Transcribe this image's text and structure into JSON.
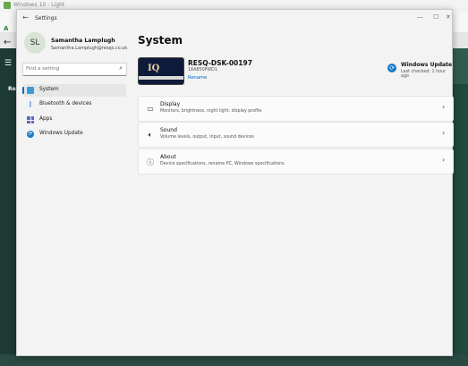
{
  "background_app": {
    "title": "Windows 10 - Light",
    "toolbar_letter": "A",
    "side_label": "Re"
  },
  "window": {
    "title": "Settings",
    "back_glyph": "←",
    "min_glyph": "—",
    "max_glyph": "☐",
    "close_glyph": "✕"
  },
  "user": {
    "initials": "SL",
    "name": "Samantha Lamplugh",
    "email": "Samantha.Lamplugh@resqs.co.uk"
  },
  "search": {
    "placeholder": "Find a setting",
    "icon": "search-icon"
  },
  "nav": [
    {
      "label": "System",
      "icon": "system-icon",
      "active": true
    },
    {
      "label": "Bluetooth & devices",
      "icon": "bluetooth-icon",
      "active": false
    },
    {
      "label": "Apps",
      "icon": "apps-icon",
      "active": false
    },
    {
      "label": "Windows Update",
      "icon": "windows-update-icon",
      "active": false
    }
  ],
  "main": {
    "title": "System",
    "device": {
      "name": "RESQ-DSK-00197",
      "model": "18A850PWD1",
      "rename_label": "Rename"
    },
    "windows_update": {
      "title": "Windows Update",
      "subtitle": "Last checked: 1 hour ago"
    },
    "cards": [
      {
        "title": "Display",
        "desc": "Monitors, brightness, night light, display profile",
        "icon": "display-icon"
      },
      {
        "title": "Sound",
        "desc": "Volume levels, output, input, sound devices",
        "icon": "sound-icon"
      },
      {
        "title": "About",
        "desc": "Device specifications, rename PC, Windows specifications",
        "icon": "info-icon"
      }
    ]
  },
  "colors": {
    "accent": "#0067c0",
    "window_bg": "#f3f3f3",
    "card_bg": "#fbfbfb"
  }
}
